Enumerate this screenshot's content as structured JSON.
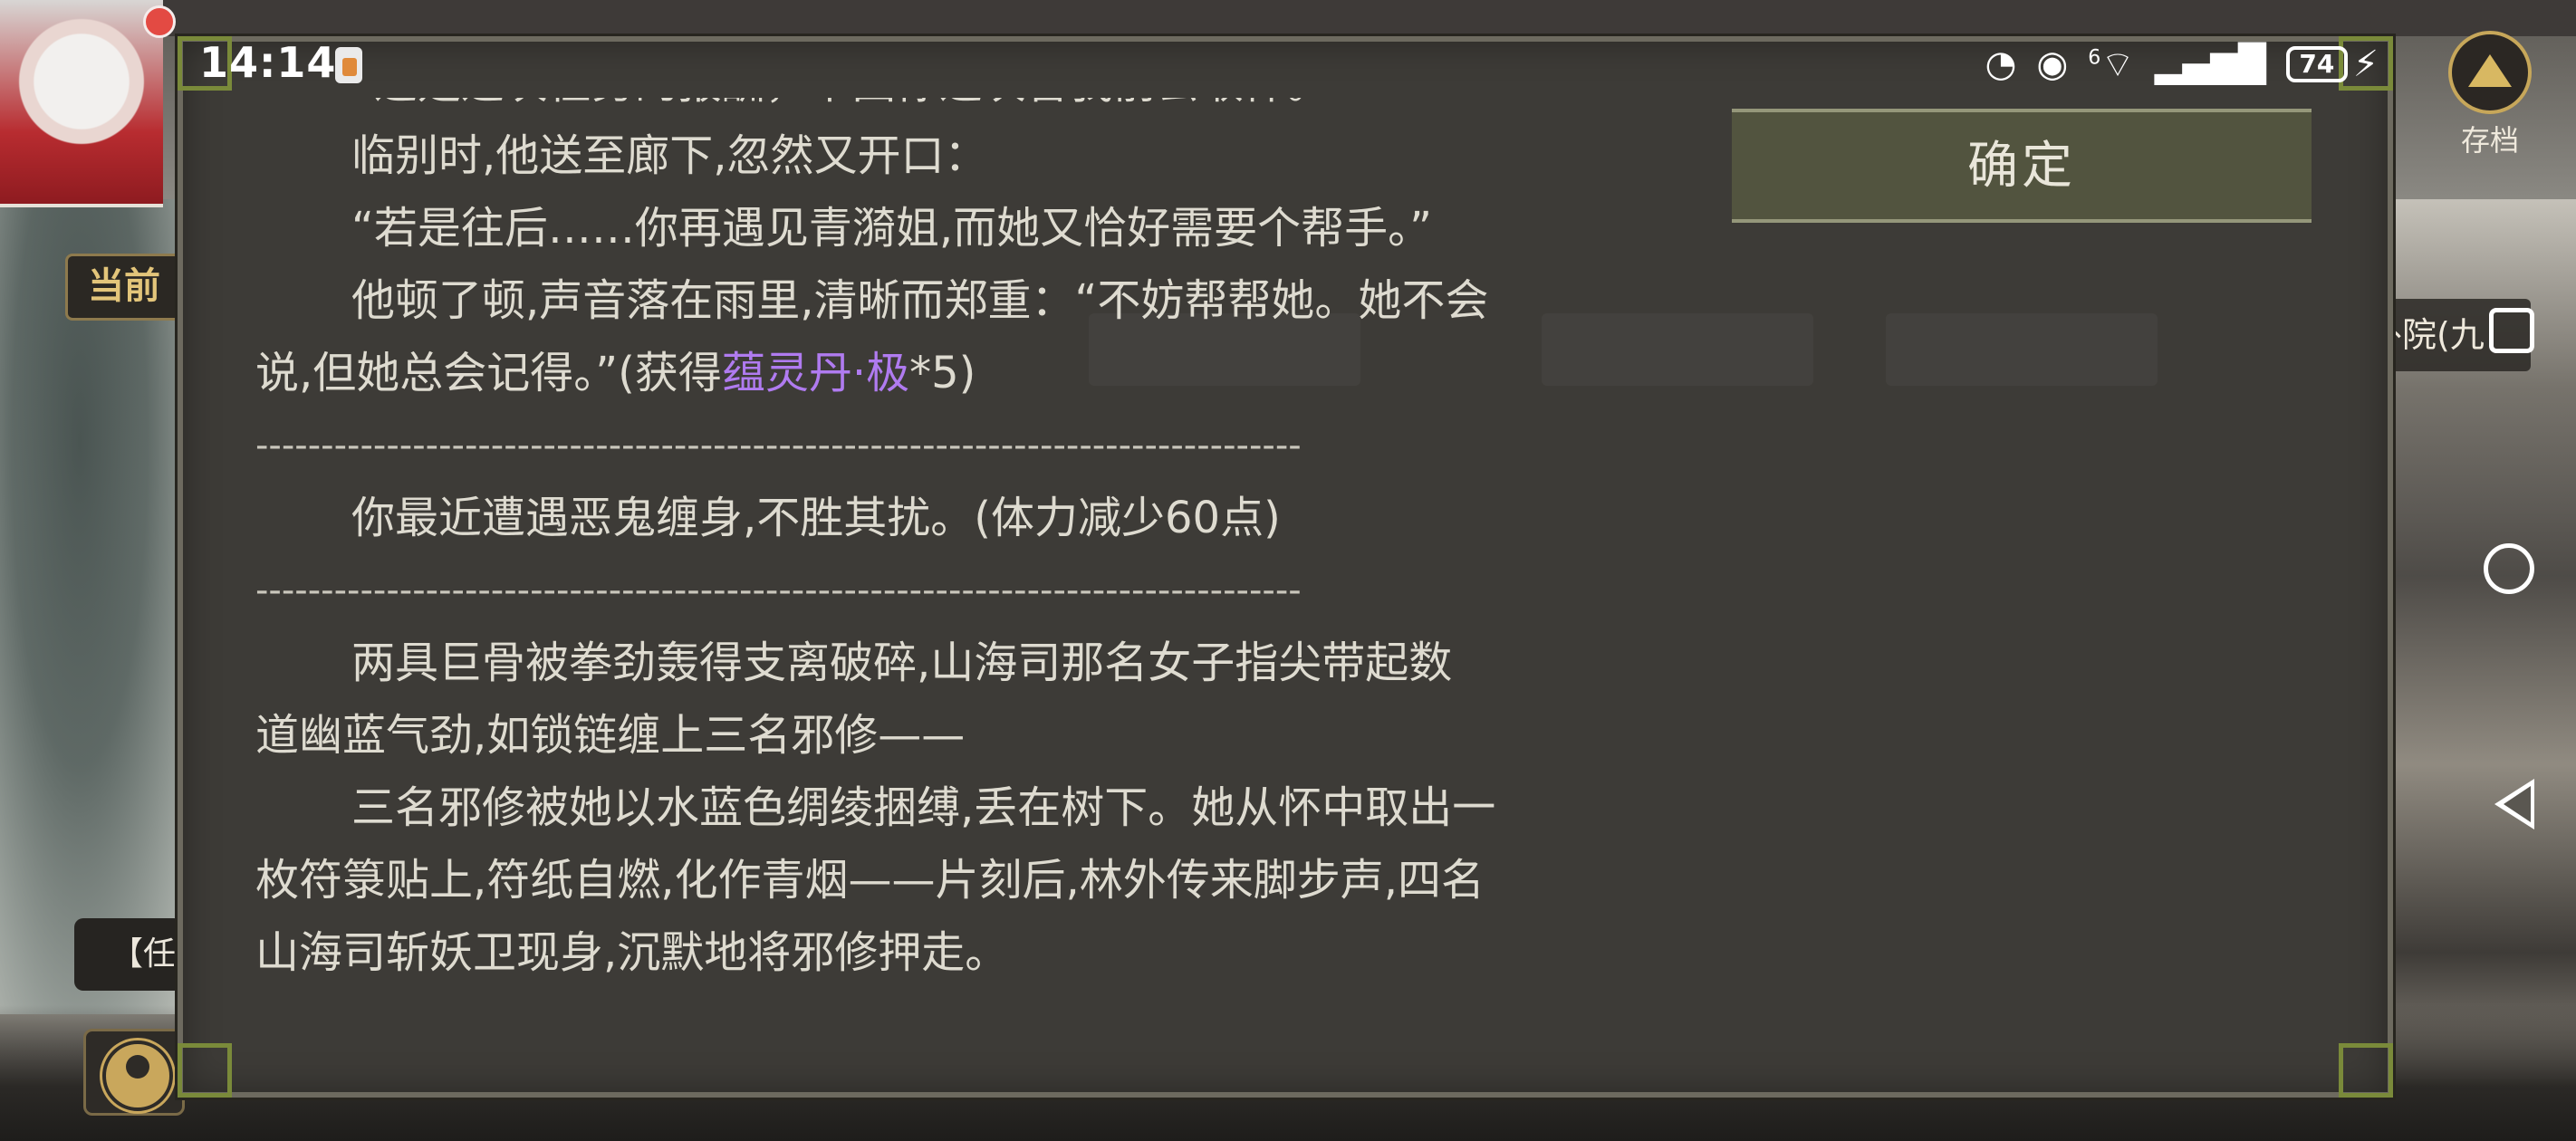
{
  "status_bar": {
    "time": "14:14",
    "network_label": "6",
    "battery": "74"
  },
  "background": {
    "current_tab_label": "当前",
    "task_pill_label": "【任",
    "location_label": "外院(九",
    "save_label": "存档"
  },
  "dialog": {
    "confirm_label": "确定",
    "lines": {
      "l0": "“这是这次任务的报酬，下回你这次替我前去取件。”",
      "l1": "临别时,他送至廊下,忽然又开口：",
      "l2": "“若是往后……你再遇见青漪姐,而她又恰好需要个帮手。”",
      "l3": "他顿了顿,声音落在雨里,清晰而郑重：“不妨帮帮她。她不会",
      "l4a": "说,但她总会记得。”(获得",
      "l4_item": "蕴灵丹·极",
      "l4b": "*5)",
      "sep1": "--------------------------------------------------------------------------------",
      "l5": "你最近遭遇恶鬼缠身,不胜其扰。(体力减少60点)",
      "sep2": "--------------------------------------------------------------------------------",
      "l6": "两具巨骨被拳劲轰得支离破碎,山海司那名女子指尖带起数",
      "l7": "道幽蓝气劲,如锁链缠上三名邪修——",
      "l8": "三名邪修被她以水蓝色绸绫捆缚,丢在树下。她从怀中取出一",
      "l9": "枚符箓贴上,符纸自燃,化作青烟——片刻后,林外传来脚步声,四名",
      "l10": "山海司斩妖卫现身,沉默地将邪修押走。"
    }
  },
  "colors": {
    "item_highlight": "#b07bf0",
    "dialog_bg": "#3d3b37",
    "confirm_bg": "#52543f",
    "text": "#dedbd0"
  },
  "icons": {
    "notification": "app-notification-icon",
    "speed": "data-saver-icon",
    "eye": "eye-comfort-icon",
    "wifi": "wifi-icon",
    "signal": "signal-icon",
    "charging": "charging-bolt-icon",
    "save": "save-archive-icon",
    "person": "person-icon",
    "nav_recents": "recents-square-icon",
    "nav_home": "home-circle-icon",
    "nav_back": "back-triangle-icon"
  }
}
